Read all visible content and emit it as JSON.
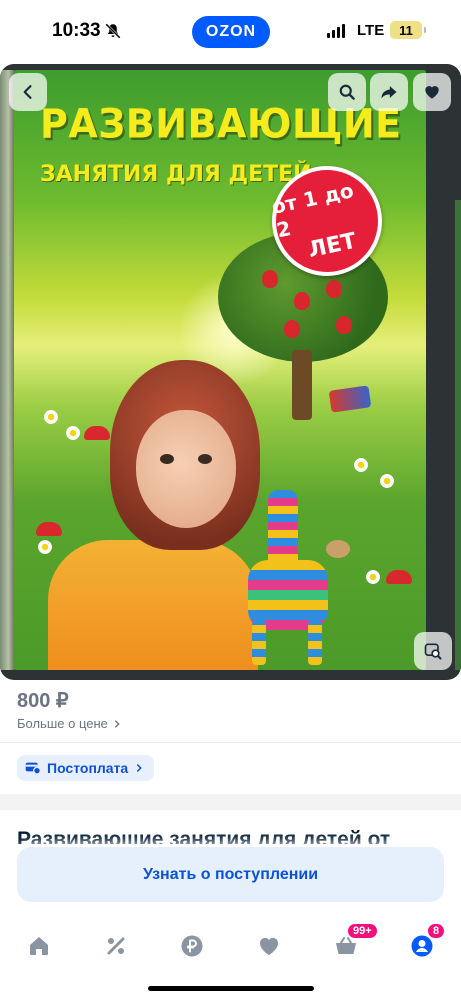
{
  "status_bar": {
    "time": "10:33",
    "app_pill": "OZON",
    "network": "LTE",
    "battery": "11"
  },
  "gallery": {
    "cover": {
      "title": "РАЗВИВАЮЩИЕ",
      "subtitle": "ЗАНЯТИЯ ДЛЯ ДЕТЕЙ",
      "age_line1": "от 1 до 2",
      "age_line2": "ЛЕТ"
    },
    "icons": {
      "back": "chevron-left-icon",
      "search": "search-icon",
      "share": "share-icon",
      "favorite": "heart-icon",
      "similar": "image-search-icon"
    }
  },
  "product": {
    "price": "800 ₽",
    "more_price_label": "Больше о цене",
    "postpay_label": "Постоплата",
    "title": "Развивающие занятия для детей от",
    "notify_button": "Узнать о поступлении"
  },
  "bottom_nav": {
    "items": [
      {
        "icon": "home-icon"
      },
      {
        "icon": "percent-icon"
      },
      {
        "icon": "ruble-icon"
      },
      {
        "icon": "heart-icon"
      },
      {
        "icon": "cart-icon",
        "badge": "99+"
      },
      {
        "icon": "profile-icon",
        "badge": "8"
      }
    ]
  },
  "colors": {
    "brand": "#005bff",
    "badge": "#f1117e",
    "link": "#0b52d6"
  }
}
